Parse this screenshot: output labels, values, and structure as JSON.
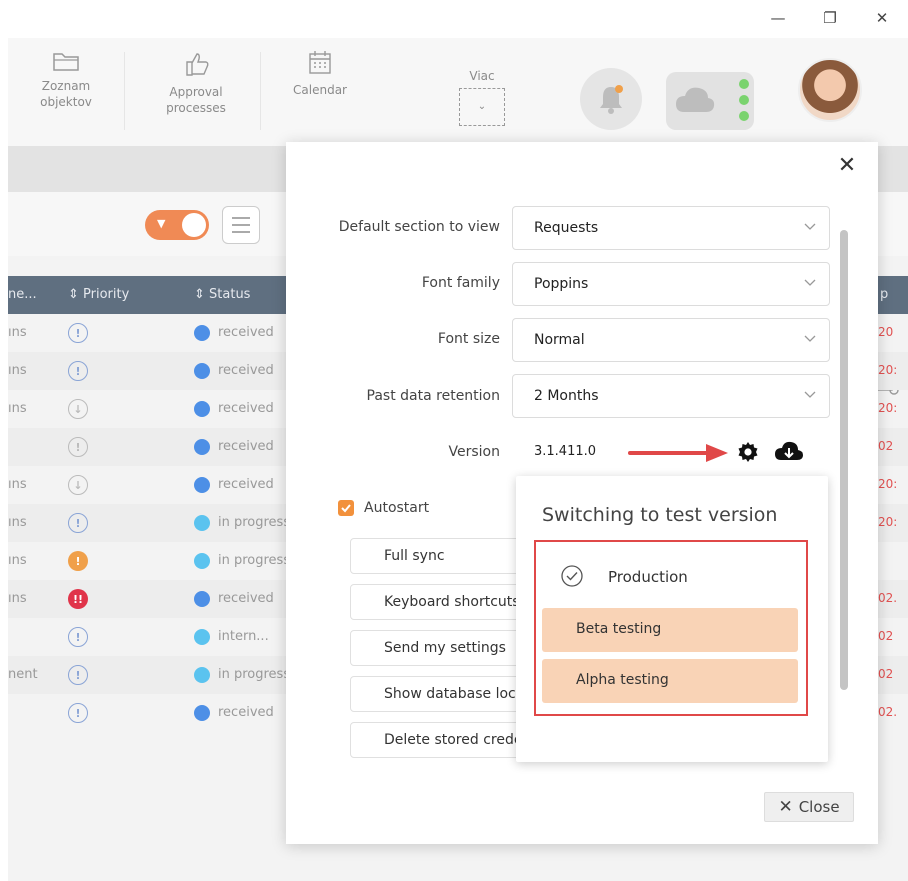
{
  "window_controls": {
    "minimize": "—",
    "restore": "❐",
    "close": "✕"
  },
  "toolbar": {
    "items": [
      {
        "label": "Zoznam objektov",
        "icon": "folder-icon"
      },
      {
        "label": "Approval processes",
        "icon": "thumbs-up-icon"
      },
      {
        "label": "Calendar",
        "icon": "calendar-icon"
      },
      {
        "label": "Viac",
        "icon": "chevron-down-icon"
      }
    ],
    "notification_color": "#f0a04a"
  },
  "table": {
    "headers": {
      "owner": "ne...",
      "priority": "Priority",
      "status": "Status",
      "right": "p"
    },
    "rows": [
      {
        "owner": "ıns",
        "priority": "!",
        "priority_kind": "info",
        "status": "received",
        "status_color": "dark",
        "right": "20"
      },
      {
        "owner": "ıns",
        "priority": "!",
        "priority_kind": "info",
        "status": "received",
        "status_color": "dark",
        "right": "20:"
      },
      {
        "owner": "ıns",
        "priority": "↓",
        "priority_kind": "low",
        "status": "received",
        "status_color": "dark",
        "right": "20:"
      },
      {
        "owner": "",
        "priority": "!",
        "priority_kind": "low",
        "status": "received",
        "status_color": "dark",
        "right": "02"
      },
      {
        "owner": "ıns",
        "priority": "↓",
        "priority_kind": "low",
        "status": "received",
        "status_color": "dark",
        "right": "20:"
      },
      {
        "owner": "ıns",
        "priority": "!",
        "priority_kind": "info",
        "status": "in progress",
        "status_color": "light",
        "right": "20:"
      },
      {
        "owner": "ıns",
        "priority": "!",
        "priority_kind": "high",
        "status": "in progress",
        "status_color": "light",
        "right": ""
      },
      {
        "owner": "ıns",
        "priority": "!!",
        "priority_kind": "urgent",
        "status": "received",
        "status_color": "dark",
        "right": "02."
      },
      {
        "owner": "",
        "priority": "!",
        "priority_kind": "info",
        "status": "intern...",
        "status_color": "light",
        "right": "02"
      },
      {
        "owner": "nent",
        "priority": "!",
        "priority_kind": "info",
        "status": "in progress",
        "status_color": "light",
        "right": "02"
      },
      {
        "owner": "",
        "priority": "!",
        "priority_kind": "info",
        "status": "received",
        "status_color": "dark",
        "right": "02."
      }
    ]
  },
  "modal": {
    "close_glyph": "✕",
    "fields": [
      {
        "label": "Default section to view",
        "value": "Requests"
      },
      {
        "label": "Font family",
        "value": "Poppins"
      },
      {
        "label": "Font size",
        "value": "Normal"
      },
      {
        "label": "Past data retention",
        "value": "2 Months"
      }
    ],
    "version_label": "Version",
    "version_value": "3.1.411.0",
    "autostart_label": "Autostart",
    "autostart_checked": true,
    "buttons": [
      "Full sync",
      "Keyboard shortcuts",
      "Send my settings",
      "Show database location",
      "Delete stored credentials"
    ],
    "footer_close": "Close",
    "footer_close_glyph": "✕"
  },
  "version_popup": {
    "title": "Switching to test version",
    "options": [
      {
        "label": "Production",
        "selected": false,
        "current": true
      },
      {
        "label": "Beta testing",
        "selected": true
      },
      {
        "label": "Alpha testing",
        "selected": true
      }
    ],
    "highlight_color": "#f9d3b6",
    "frame_color": "#e04848"
  },
  "colors": {
    "accent": "#f08a55",
    "header_bg": "#5f6f80",
    "status_dark": "#4d8fe6",
    "status_light": "#5bc3ef",
    "arrow": "#e04848"
  }
}
